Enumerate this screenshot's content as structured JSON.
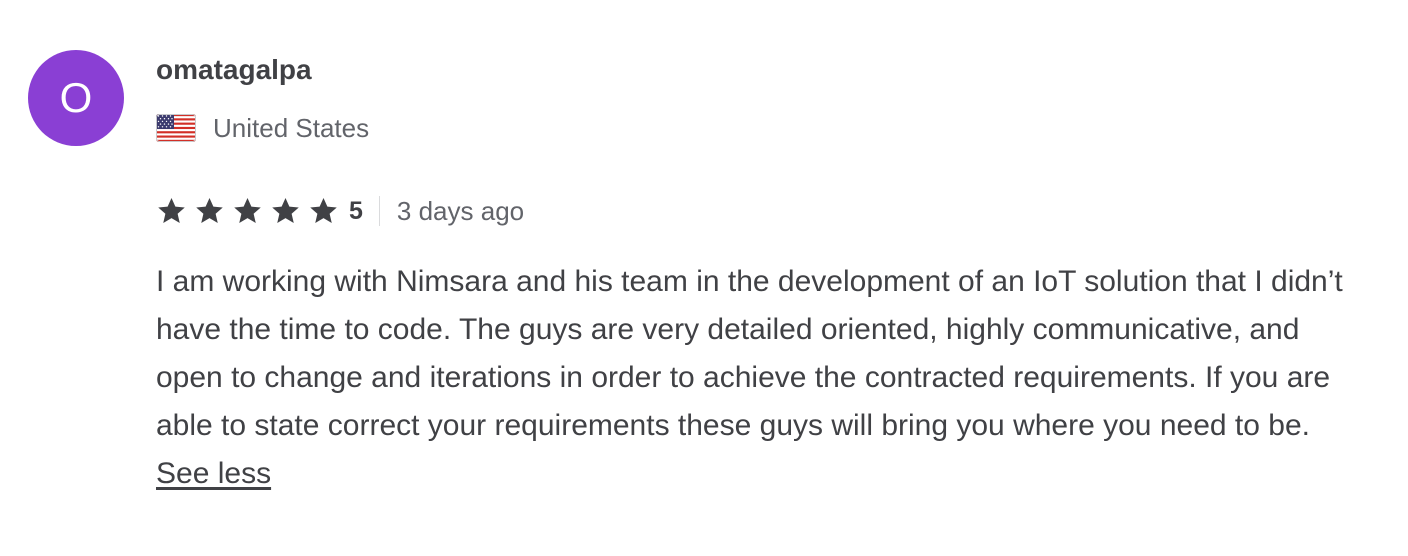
{
  "review": {
    "avatar_letter": "O",
    "avatar_color": "#8a3fd4",
    "username": "omatagalpa",
    "country": "United States",
    "flag_icon": "us-flag-icon",
    "rating": "5",
    "rating_stars": 5,
    "star_color": "#404145",
    "time_ago": "3 days ago",
    "text": "I am working with Nimsara and his team in the development of an IoT solution that I didn’t have the time to code. The guys are very detailed oriented, highly communicative, and open to change and iterations in order to achieve the contracted requirements. If you are able to state correct your requirements these guys will bring you where you need to be.",
    "see_less_label": "See less"
  }
}
